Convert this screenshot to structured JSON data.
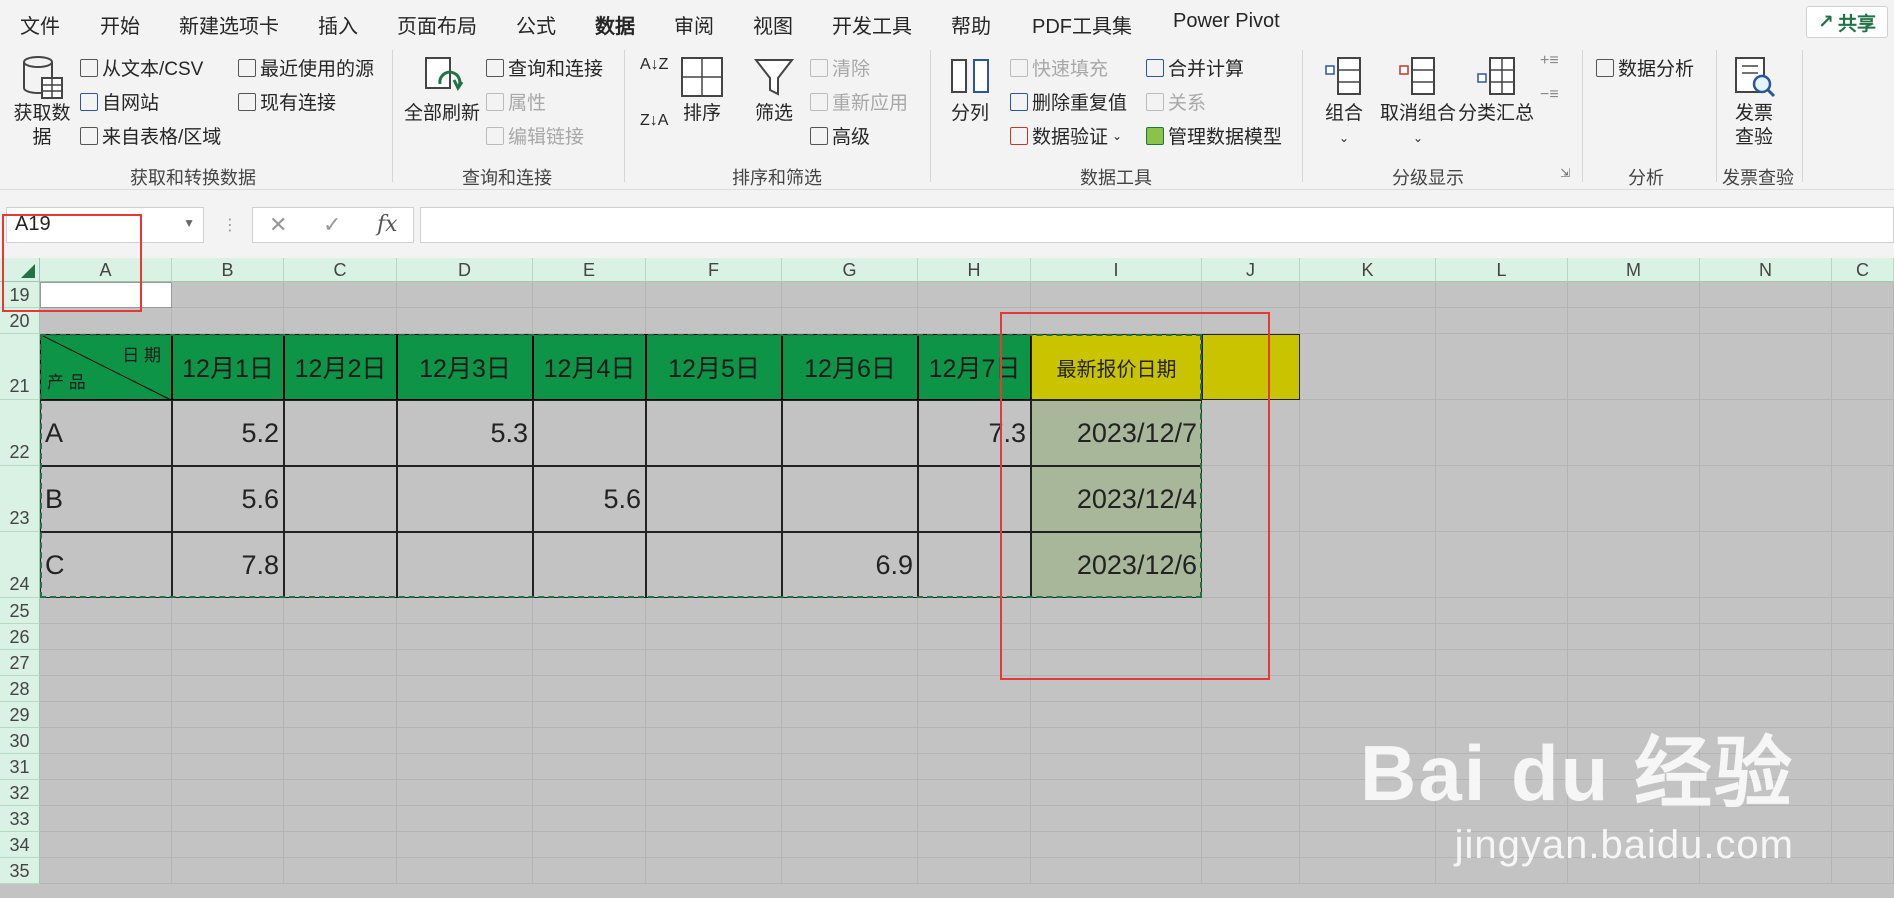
{
  "menu": {
    "tabs": [
      "文件",
      "开始",
      "新建选项卡",
      "插入",
      "页面布局",
      "公式",
      "数据",
      "审阅",
      "视图",
      "开发工具",
      "帮助",
      "PDF工具集",
      "Power Pivot"
    ],
    "active": "数据",
    "share": "共享"
  },
  "ribbon": {
    "get_data": "获取数据",
    "from_text": "从文本/CSV",
    "from_web": "自网站",
    "from_table": "来自表格/区域",
    "recent_sources": "最近使用的源",
    "existing_connections": "现有连接",
    "group1": "获取和转换数据",
    "refresh_all": "全部刷新",
    "queries_connections": "查询和连接",
    "properties": "属性",
    "edit_links": "编辑链接",
    "group2": "查询和连接",
    "sort": "排序",
    "filter": "筛选",
    "clear": "清除",
    "reapply": "重新应用",
    "advanced": "高级",
    "group3": "排序和筛选",
    "text_to_columns": "分列",
    "flash_fill": "快速填充",
    "remove_duplicates": "删除重复值",
    "data_validation": "数据验证",
    "consolidate": "合并计算",
    "relationships": "关系",
    "manage_model": "管理数据模型",
    "group4": "数据工具",
    "group_btn": "组合",
    "ungroup": "取消组合",
    "subtotal": "分类汇总",
    "group5": "分级显示",
    "data_analysis": "数据分析",
    "group6": "分析",
    "invoice_check": "发票查验",
    "group7": "发票查验"
  },
  "formula_bar": {
    "name_box": "A19",
    "fx": "fx",
    "cancel": "✕",
    "confirm": "✓",
    "formula": ""
  },
  "columns": [
    "A",
    "B",
    "C",
    "D",
    "E",
    "F",
    "G",
    "H",
    "I",
    "J",
    "K",
    "L",
    "M",
    "N",
    "C"
  ],
  "rows": [
    "19",
    "20",
    "21",
    "22",
    "23",
    "24",
    "25",
    "26",
    "27",
    "28",
    "29",
    "30",
    "31",
    "32",
    "33",
    "34",
    "35"
  ],
  "table": {
    "corner_top": "日 期",
    "corner_bottom": "产 品",
    "dates": [
      "12月1日",
      "12月2日",
      "12月3日",
      "12月4日",
      "12月5日",
      "12月6日",
      "12月7日"
    ],
    "latest_header": "最新报价日期",
    "rows": [
      {
        "product": "A",
        "values": [
          "5.2",
          "",
          "5.3",
          "",
          "",
          "",
          "7.3"
        ],
        "latest": "2023/12/7"
      },
      {
        "product": "B",
        "values": [
          "5.6",
          "",
          "",
          "5.6",
          "",
          "",
          ""
        ],
        "latest": "2023/12/4"
      },
      {
        "product": "C",
        "values": [
          "7.8",
          "",
          "",
          "",
          "",
          "6.9",
          ""
        ],
        "latest": "2023/12/6"
      }
    ]
  },
  "watermark": {
    "main": "Bai du 经验",
    "sub": "jingyan.baidu.com"
  }
}
